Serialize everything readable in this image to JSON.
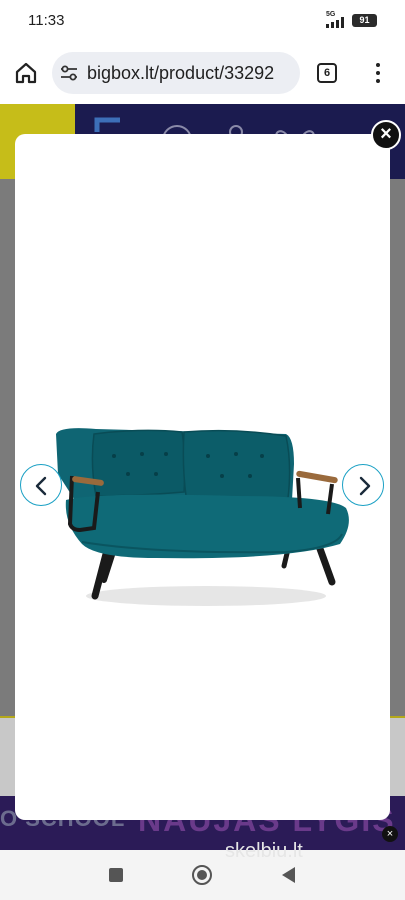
{
  "status_bar": {
    "time": "11:33",
    "network": "5G",
    "battery": "91"
  },
  "browser": {
    "url": "bigbox.lt/product/33292",
    "tab_count": "6"
  },
  "background_page": {
    "promo_left": "O SCHOOL",
    "promo_right": "NAUJAS LYGIS",
    "watermark": "skelbiu.lt",
    "ad_close": "×"
  },
  "modal": {
    "close_label": "×",
    "image_icon": "teal-sofa-bed-image",
    "prev_icon": "chevron-left-icon",
    "next_icon": "chevron-right-icon",
    "accent_color": "#1aa0c4",
    "sofa_color": "#0e5f6a"
  }
}
